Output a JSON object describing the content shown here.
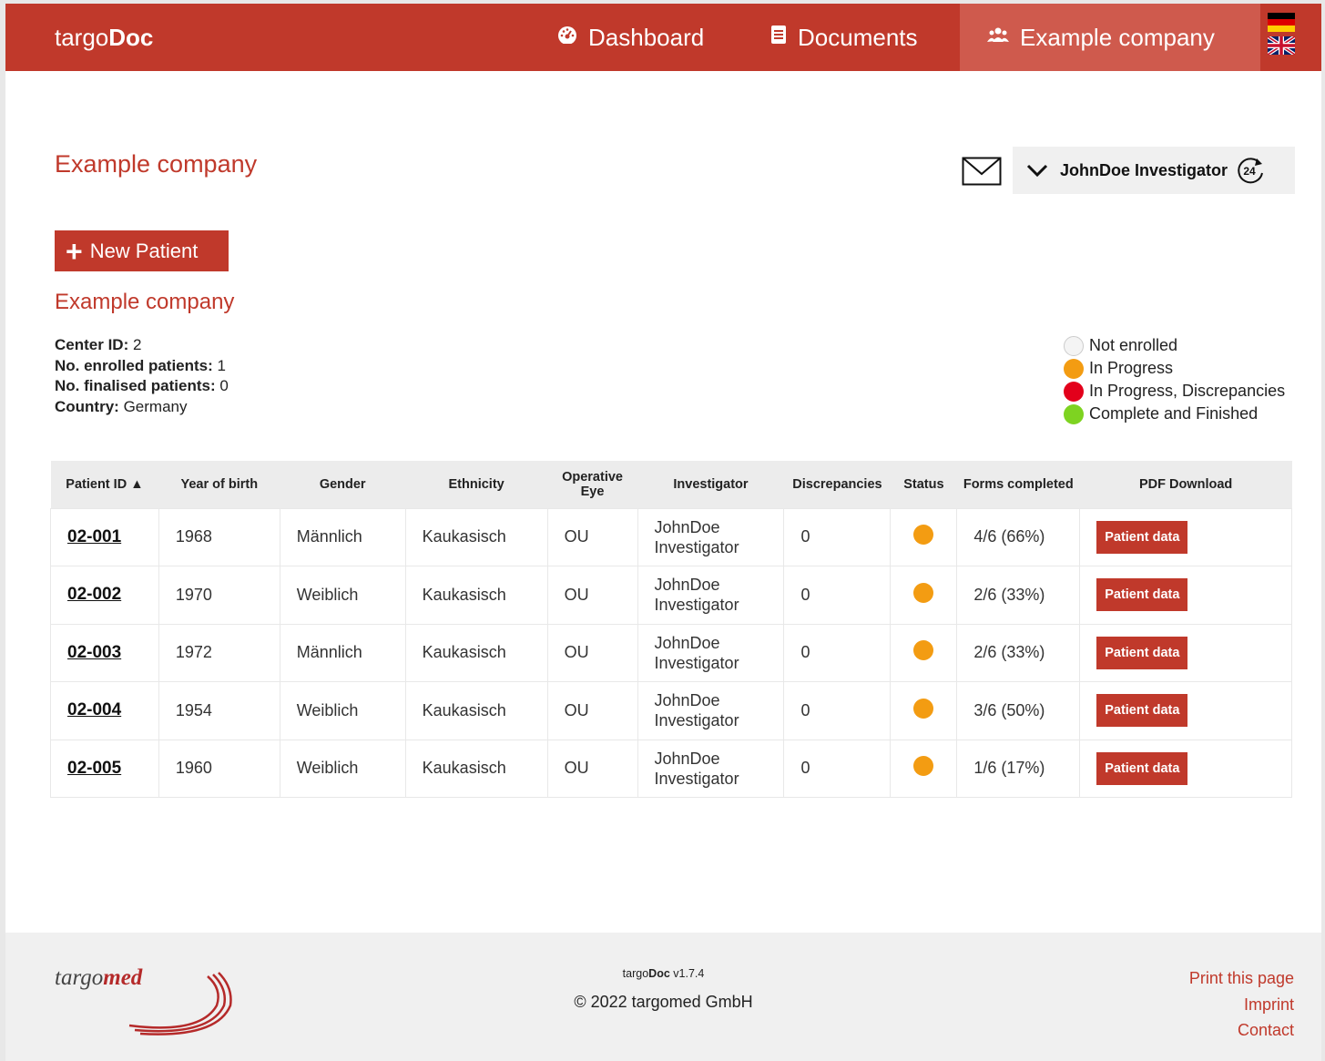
{
  "nav": {
    "brand_light": "targo",
    "brand_bold": "Doc",
    "items": [
      {
        "label": "Dashboard",
        "icon": "dashboard-icon"
      },
      {
        "label": "Documents",
        "icon": "document-icon"
      },
      {
        "label": "Example company",
        "icon": "users-icon"
      }
    ],
    "languages": [
      "German",
      "English"
    ]
  },
  "header": {
    "title": "Example company",
    "user_label": "JohnDoe Investigator",
    "refresh_badge": "24"
  },
  "actions": {
    "new_patient_label": "New Patient"
  },
  "center": {
    "title": "Example company",
    "center_id_label": "Center ID:",
    "center_id_value": "2",
    "enrolled_label": "No. enrolled patients:",
    "enrolled_value": "1",
    "finalised_label": "No. finalised patients:",
    "finalised_value": "0",
    "country_label": "Country:",
    "country_value": "Germany"
  },
  "legend": [
    {
      "label": "Not enrolled",
      "color": "#f4f4f4"
    },
    {
      "label": "In Progress",
      "color": "#f39c12"
    },
    {
      "label": "In Progress, Discrepancies",
      "color": "#e3001b"
    },
    {
      "label": "Complete and Finished",
      "color": "#7ed321"
    }
  ],
  "table": {
    "headers": {
      "patient_id": "Patient ID ▲",
      "year": "Year of birth",
      "gender": "Gender",
      "ethnicity": "Ethnicity",
      "eye_line1": "Operative",
      "eye_line2": "Eye",
      "investigator": "Investigator",
      "discrepancies": "Discrepancies",
      "status": "Status",
      "forms": "Forms completed",
      "pdf": "PDF Download"
    },
    "rows": [
      {
        "id": "02-001",
        "year": "1968",
        "gender": "Männlich",
        "ethnicity": "Kaukasisch",
        "eye": "OU",
        "inv1": "JohnDoe",
        "inv2": "Investigator",
        "disc": "0",
        "status": "In Progress",
        "forms": "4/6 (66%)",
        "pdf": "Patient data"
      },
      {
        "id": "02-002",
        "year": "1970",
        "gender": "Weiblich",
        "ethnicity": "Kaukasisch",
        "eye": "OU",
        "inv1": "JohnDoe",
        "inv2": "Investigator",
        "disc": "0",
        "status": "In Progress",
        "forms": "2/6 (33%)",
        "pdf": "Patient data"
      },
      {
        "id": "02-003",
        "year": "1972",
        "gender": "Männlich",
        "ethnicity": "Kaukasisch",
        "eye": "OU",
        "inv1": "JohnDoe",
        "inv2": "Investigator",
        "disc": "0",
        "status": "In Progress",
        "forms": "2/6 (33%)",
        "pdf": "Patient data"
      },
      {
        "id": "02-004",
        "year": "1954",
        "gender": "Weiblich",
        "ethnicity": "Kaukasisch",
        "eye": "OU",
        "inv1": "JohnDoe",
        "inv2": "Investigator",
        "disc": "0",
        "status": "In Progress",
        "forms": "3/6 (50%)",
        "pdf": "Patient data"
      },
      {
        "id": "02-005",
        "year": "1960",
        "gender": "Weiblich",
        "ethnicity": "Kaukasisch",
        "eye": "OU",
        "inv1": "JohnDoe",
        "inv2": "Investigator",
        "disc": "0",
        "status": "In Progress",
        "forms": "1/6 (17%)",
        "pdf": "Patient data"
      }
    ]
  },
  "footer": {
    "logo_light": "targo",
    "logo_bold": "med",
    "version_light": "targo",
    "version_bold": "Doc",
    "version": " v1.7.4",
    "copyright": "© 2022 targomed GmbH",
    "links": [
      "Print this page",
      "Imprint",
      "Contact"
    ]
  }
}
